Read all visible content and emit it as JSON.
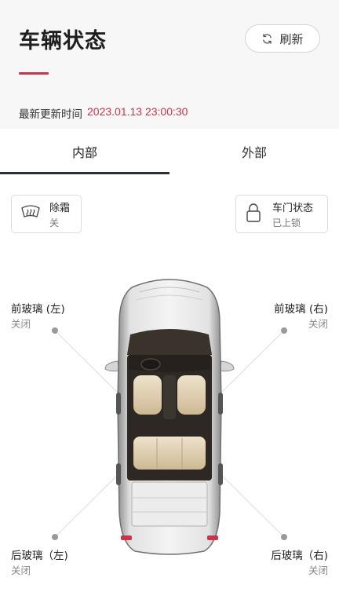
{
  "header": {
    "title": "车辆状态",
    "refresh_label": "刷新",
    "update_label": "最新更新时间",
    "update_time": "2023.01.13 23:00:30"
  },
  "tabs": [
    {
      "label": "内部",
      "active": true
    },
    {
      "label": "外部",
      "active": false
    }
  ],
  "status": {
    "defrost": {
      "title": "除霜",
      "value": "关",
      "icon": "defrost-icon"
    },
    "door": {
      "title": "车门状态",
      "value": "已上锁",
      "icon": "lock-icon"
    }
  },
  "windows": {
    "front_left": {
      "label": "前玻璃 (左)",
      "state": "关闭"
    },
    "front_right": {
      "label": "前玻璃 (右)",
      "state": "关闭"
    },
    "rear_left": {
      "label": "后玻璃（左)",
      "state": "关闭"
    },
    "rear_right": {
      "label": "后玻璃（右)",
      "state": "关闭"
    }
  },
  "colors": {
    "accent": "#c8354a",
    "tab_indicator": "#2a2f3a",
    "header_bg": "#f7f7f7"
  }
}
